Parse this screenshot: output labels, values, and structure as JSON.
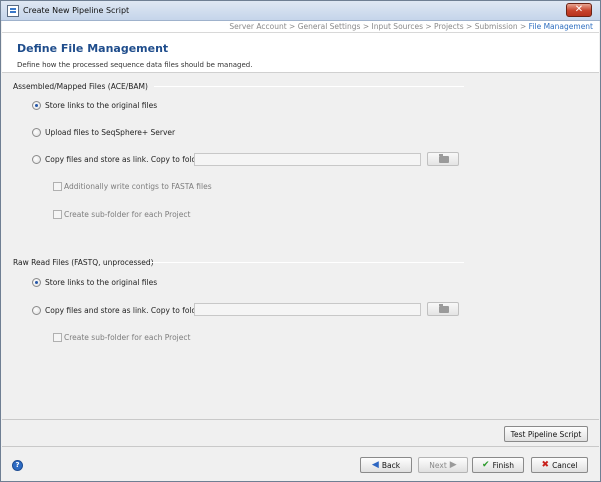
{
  "window": {
    "title": "Create New Pipeline Script",
    "close_glyph": "✕"
  },
  "breadcrumb": {
    "steps": [
      "Server Account",
      "General Settings",
      "Input Sources",
      "Projects",
      "Submission"
    ],
    "separator": " > ",
    "current": "File Management"
  },
  "header": {
    "title": "Define File Management",
    "subtitle": "Define how the processed sequence data files should be managed."
  },
  "assembled": {
    "section_title": "Assembled/Mapped Files (ACE/BAM)",
    "opt_links": "Store links to the original files",
    "opt_upload": "Upload files to SeqSphere+ Server",
    "opt_copy": "Copy files and store as link. Copy to folder:",
    "folder_value": "",
    "chk_fasta": "Additionally write contigs to FASTA files",
    "chk_subfolder": "Create sub-folder for each Project",
    "selected": "opt_links"
  },
  "raw": {
    "section_title": "Raw Read Files (FASTQ, unprocessed)",
    "opt_links": "Store links to the original files",
    "opt_copy": "Copy files and store as link. Copy to folder:",
    "folder_value": "",
    "chk_subfolder": "Create sub-folder for each Project",
    "selected": "opt_links"
  },
  "buttons": {
    "test": "Test Pipeline Script",
    "back": "Back",
    "next": "Next",
    "finish": "Finish",
    "cancel": "Cancel"
  },
  "icons": {
    "help": "?",
    "back": "◀",
    "next": "▶",
    "finish": "✔",
    "cancel": "✖"
  },
  "colors": {
    "title_accent": "#1f4d8c",
    "breadcrumb_current": "#2f6fc0",
    "close_button": "#c7432b"
  }
}
